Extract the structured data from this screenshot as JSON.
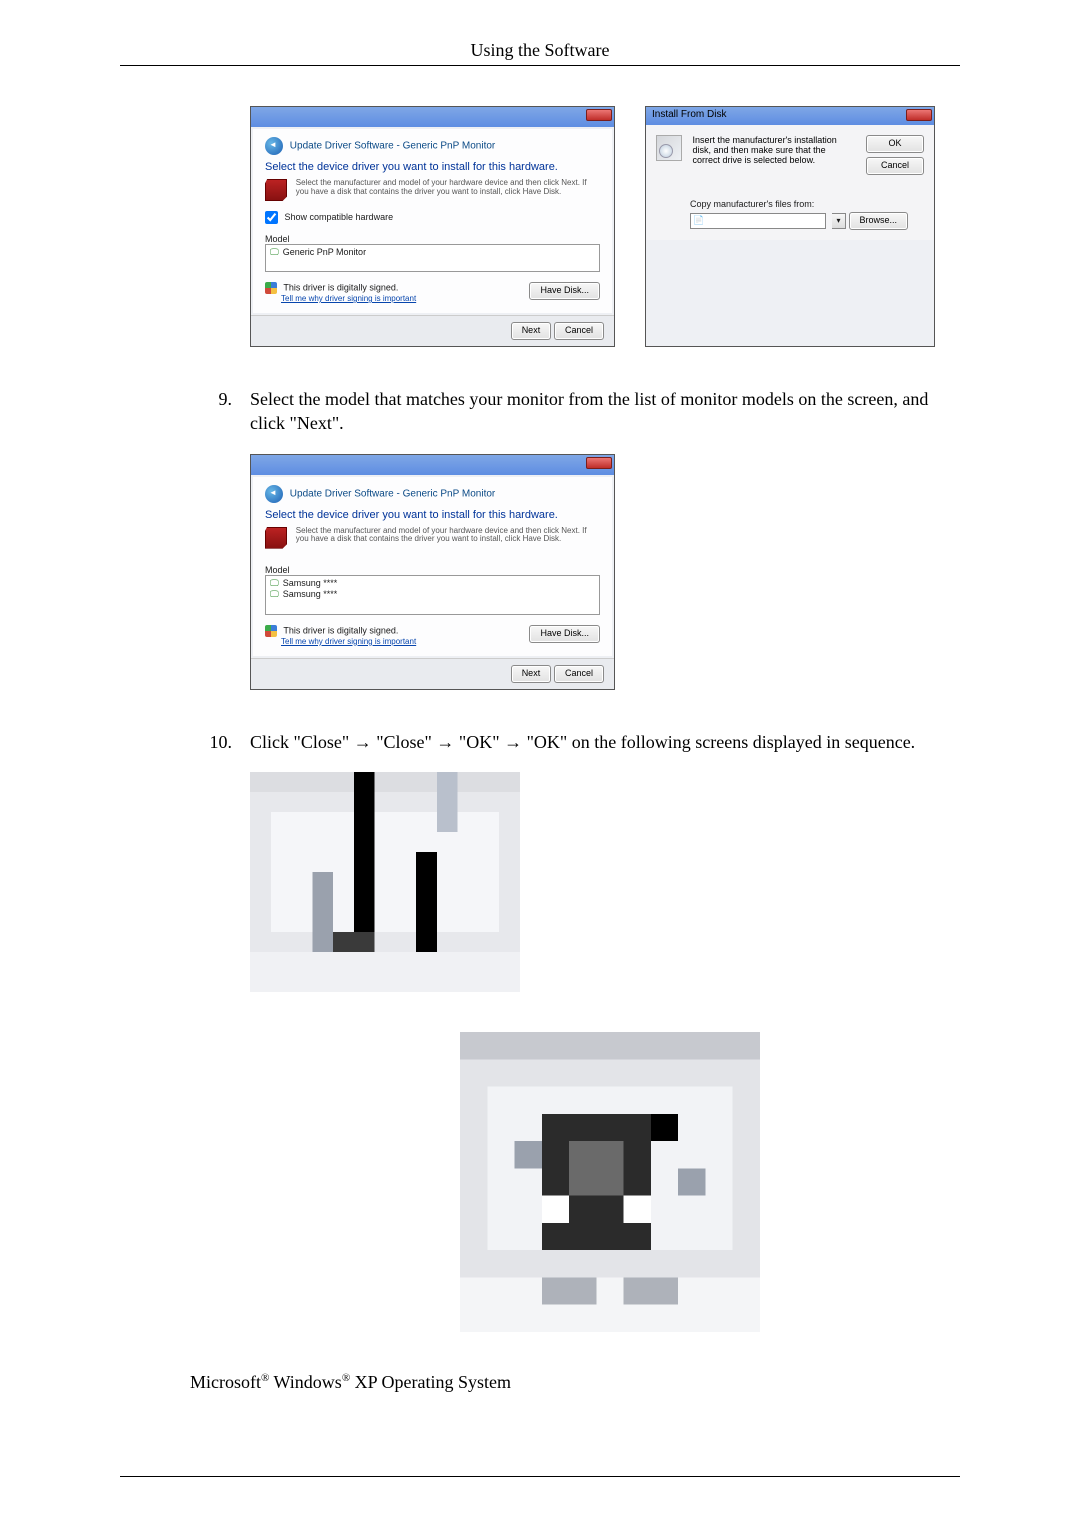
{
  "header": {
    "title": "Using the Software"
  },
  "dialogA": {
    "breadcrumb": "Update Driver Software - Generic PnP Monitor",
    "heading": "Select the device driver you want to install for this hardware.",
    "description": "Select the manufacturer and model of your hardware device and then click Next. If you have a disk that contains the driver you want to install, click Have Disk.",
    "show_compatible_label": "Show compatible hardware",
    "model_label": "Model",
    "model_item": "Generic PnP Monitor",
    "signed_text": "This driver is digitally signed.",
    "signed_link": "Tell me why driver signing is important",
    "have_disk_btn": "Have Disk...",
    "next_btn": "Next",
    "cancel_btn": "Cancel"
  },
  "dialogB": {
    "title": "Install From Disk",
    "message": "Insert the manufacturer's installation disk, and then make sure that the correct drive is selected below.",
    "ok_btn": "OK",
    "cancel_btn": "Cancel",
    "copy_label": "Copy manufacturer's files from:",
    "browse_btn": "Browse..."
  },
  "steps": {
    "s9_num": "9.",
    "s9_text": "Select the model that matches your monitor from the list of monitor models on the screen, and click \"Next\".",
    "s10_num": "10.",
    "s10_text": "Click \"Close\" → \"Close\" → \"OK\" → \"OK\" on the following screens displayed in sequence."
  },
  "dialogC": {
    "breadcrumb": "Update Driver Software - Generic PnP Monitor",
    "heading": "Select the device driver you want to install for this hardware.",
    "description": "Select the manufacturer and model of your hardware device and then click Next. If you have a disk that contains the driver you want to install, click Have Disk.",
    "model_label": "Model",
    "model_item1": "Samsung ****",
    "model_item2": "Samsung ****",
    "signed_text": "This driver is digitally signed.",
    "signed_link": "Tell me why driver signing is important",
    "have_disk_btn": "Have Disk...",
    "next_btn": "Next",
    "cancel_btn": "Cancel"
  },
  "footer": {
    "line_pre": "Microsoft",
    "line_mid": " Windows",
    "line_post": " XP Operating System",
    "reg": "®"
  }
}
